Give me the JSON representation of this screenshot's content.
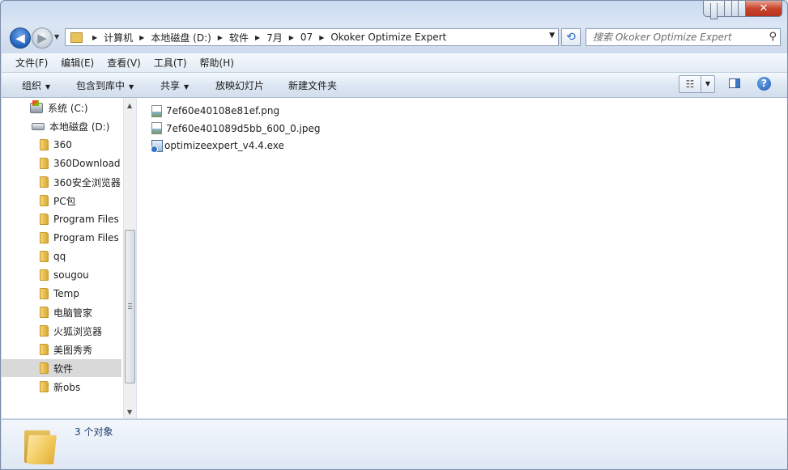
{
  "window": {
    "min_glyph": "minimize-icon",
    "max_glyph": "maximize-icon",
    "close_label": "✕"
  },
  "nav": {
    "back_glyph": "◀",
    "forward_glyph": "▶"
  },
  "address": {
    "crumbs": [
      "计算机",
      "本地磁盘 (D:)",
      "软件",
      "7月",
      "07",
      "Okoker Optimize Expert"
    ]
  },
  "search": {
    "placeholder": "搜索 Okoker Optimize Expert"
  },
  "menu": [
    "文件(F)",
    "编辑(E)",
    "查看(V)",
    "工具(T)",
    "帮助(H)"
  ],
  "toolbar": {
    "organize": "组织",
    "include_library": "包含到库中",
    "share": "共享",
    "slideshow": "放映幻灯片",
    "new_folder": "新建文件夹",
    "help": "?"
  },
  "tree": [
    {
      "label": "系统 (C:)",
      "icon": "system-drive-icon"
    },
    {
      "label": "本地磁盘 (D:)",
      "icon": "drive-icon"
    },
    {
      "label": "360",
      "icon": "folder-icon"
    },
    {
      "label": "360Download",
      "icon": "folder-icon"
    },
    {
      "label": "360安全浏览器",
      "icon": "folder-icon"
    },
    {
      "label": "PC包",
      "icon": "folder-icon"
    },
    {
      "label": "Program Files",
      "icon": "folder-icon"
    },
    {
      "label": "Program Files",
      "icon": "folder-icon"
    },
    {
      "label": "qq",
      "icon": "folder-icon"
    },
    {
      "label": "sougou",
      "icon": "folder-icon"
    },
    {
      "label": "Temp",
      "icon": "folder-icon"
    },
    {
      "label": "电脑管家",
      "icon": "folder-icon"
    },
    {
      "label": "火狐浏览器",
      "icon": "folder-icon"
    },
    {
      "label": "美图秀秀",
      "icon": "folder-icon"
    },
    {
      "label": "软件",
      "icon": "folder-icon",
      "selected": true
    },
    {
      "label": "新obs",
      "icon": "folder-icon"
    }
  ],
  "files": [
    {
      "name": "7ef60e40108e81ef.png",
      "icon": "image-file-icon"
    },
    {
      "name": "7ef60e401089d5bb_600_0.jpeg",
      "icon": "image-file-icon"
    },
    {
      "name": "optimizeexpert_v4.4.exe",
      "icon": "installer-icon"
    }
  ],
  "details": {
    "count": "3 个对象"
  }
}
